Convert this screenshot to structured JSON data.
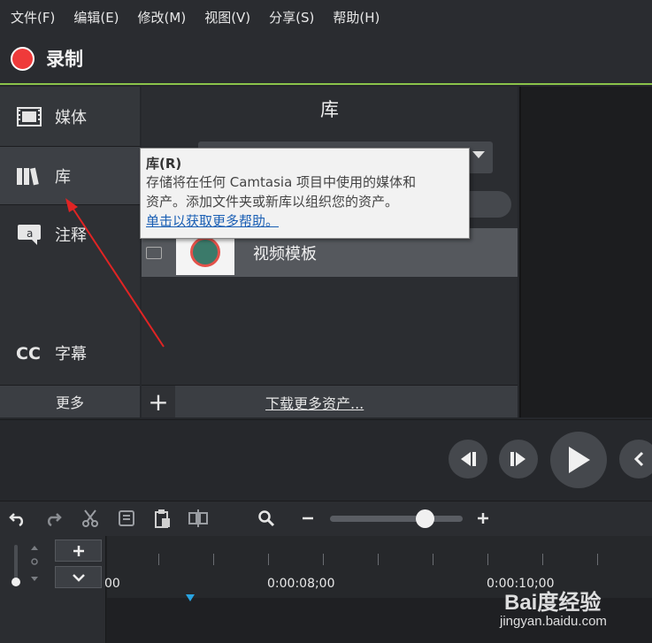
{
  "menu": {
    "items": [
      "文件(F)",
      "编辑(E)",
      "修改(M)",
      "视图(V)",
      "分享(S)",
      "帮助(H)"
    ]
  },
  "record": {
    "label": "录制",
    "accent": "#ef3a3a",
    "bar_accent": "#8bc34a"
  },
  "tabs": {
    "media": "媒体",
    "library": "库",
    "annotations": "注释",
    "captions": "字幕",
    "more": "更多"
  },
  "library": {
    "title": "库",
    "item_name": "视频模板",
    "add_label": "+",
    "download_label": "下载更多资产..."
  },
  "tooltip": {
    "title": "库(R)",
    "line1": "存储将在任何 Camtasia 项目中使用的媒体和",
    "line2": "资产。添加文件夹或新库以组织您的资产。",
    "link": "单击以获取更多帮助。"
  },
  "timeline": {
    "tick_labels": [
      "00",
      "0:00:08;00",
      "0:00:10;00"
    ],
    "playhead_color": "#29a3e0"
  },
  "watermark": {
    "brand": "Bai度经验",
    "url": "jingyan.baidu.com"
  }
}
